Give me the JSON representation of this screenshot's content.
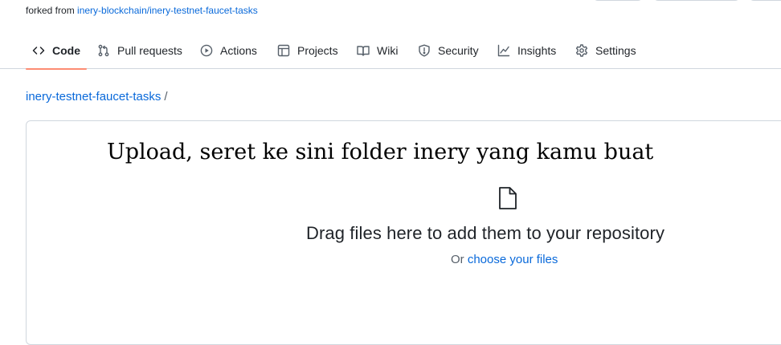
{
  "fork": {
    "prefix": "forked from",
    "source_link": "inery-blockchain/inery-testnet-faucet-tasks"
  },
  "tabs": [
    {
      "label": "Code",
      "icon": "code-icon",
      "selected": true
    },
    {
      "label": "Pull requests",
      "icon": "pull-request-icon",
      "selected": false
    },
    {
      "label": "Actions",
      "icon": "play-circle-icon",
      "selected": false
    },
    {
      "label": "Projects",
      "icon": "table-icon",
      "selected": false
    },
    {
      "label": "Wiki",
      "icon": "book-icon",
      "selected": false
    },
    {
      "label": "Security",
      "icon": "shield-icon",
      "selected": false
    },
    {
      "label": "Insights",
      "icon": "graph-icon",
      "selected": false
    },
    {
      "label": "Settings",
      "icon": "gear-icon",
      "selected": false
    }
  ],
  "breadcrumb": {
    "repo": "inery-testnet-faucet-tasks",
    "separator": "/"
  },
  "annotation": "Upload, seret ke sini folder inery yang kamu buat",
  "upload": {
    "icon": "file-icon",
    "title": "Drag files here to add them to your repository",
    "or_text": "Or",
    "choose_link": "choose your files"
  },
  "colors": {
    "link": "#0969da",
    "selected_tab_underline": "#fd8c73",
    "border": "#d0d7de"
  }
}
